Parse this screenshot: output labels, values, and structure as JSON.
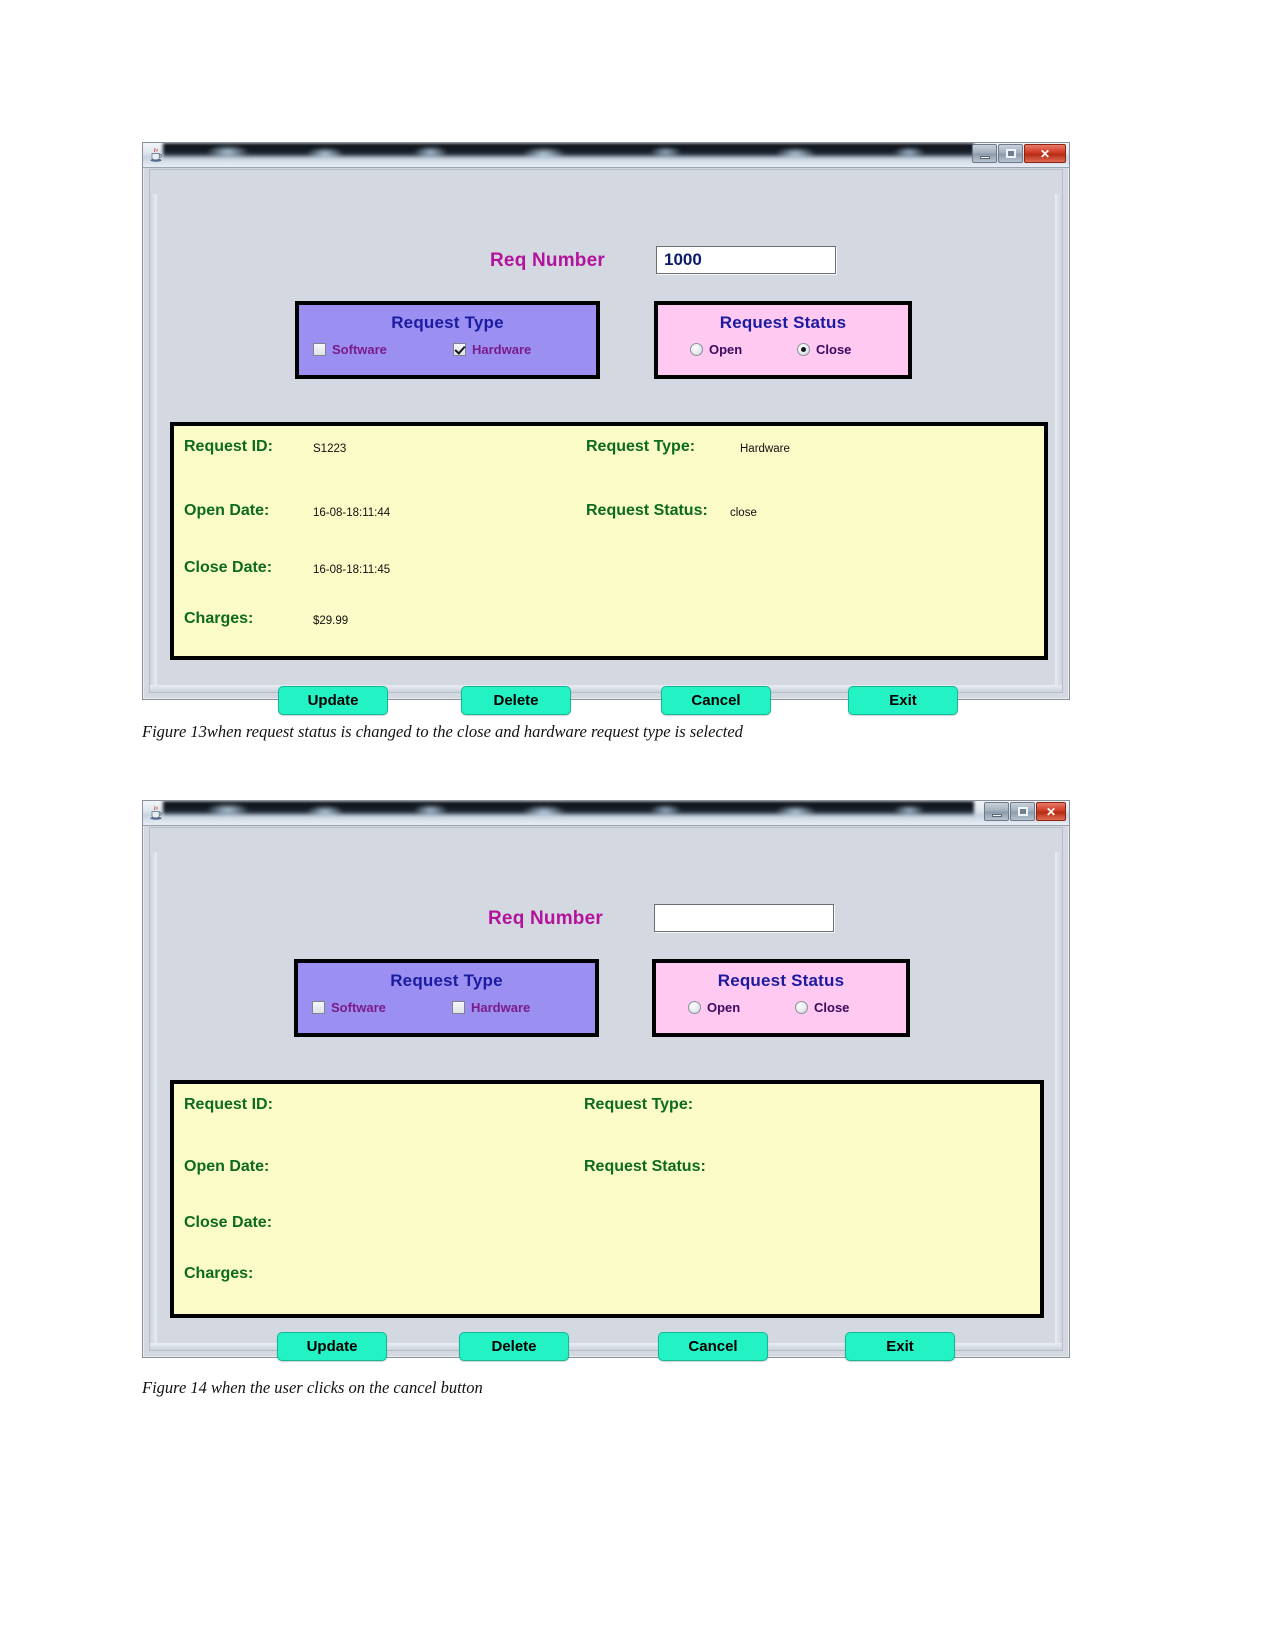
{
  "document": {
    "figures": [
      {
        "id": "figure-13",
        "caption": "Figure 13when request status is changed to the close and hardware request type is selected",
        "window": {
          "title": "",
          "app_icon": "java-coffee-cup-icon",
          "controls": {
            "minimize": "–",
            "maximize": "□",
            "close": "✕"
          }
        },
        "form": {
          "req_number": {
            "label": "Req Number",
            "value": "1000",
            "placeholder": ""
          },
          "request_type": {
            "title": "Request Type",
            "options": [
              {
                "label": "Software",
                "checked": false
              },
              {
                "label": "Hardware",
                "checked": true
              }
            ]
          },
          "request_status": {
            "title": "Request Status",
            "options": [
              {
                "label": "Open",
                "selected": false
              },
              {
                "label": "Close",
                "selected": true
              }
            ]
          },
          "details": [
            {
              "label": "Request ID:",
              "value": "S1223"
            },
            {
              "label": "Request Type:",
              "value": "Hardware"
            },
            {
              "label": "Open Date:",
              "value": "16-08-18:11:44"
            },
            {
              "label": "Request Status:",
              "value": "close"
            },
            {
              "label": "Close Date:",
              "value": "16-08-18:11:45"
            },
            {
              "label": "Charges:",
              "value": "$29.99"
            }
          ],
          "buttons": [
            {
              "label": "Update"
            },
            {
              "label": "Delete"
            },
            {
              "label": "Cancel"
            },
            {
              "label": "Exit"
            }
          ]
        }
      },
      {
        "id": "figure-14",
        "caption": "Figure 14 when the user clicks on the cancel button",
        "window": {
          "title": "",
          "app_icon": "java-coffee-cup-icon",
          "controls": {
            "minimize": "–",
            "maximize": "□",
            "close": "✕"
          }
        },
        "form": {
          "req_number": {
            "label": "Req Number",
            "value": "",
            "placeholder": ""
          },
          "request_type": {
            "title": "Request Type",
            "options": [
              {
                "label": "Software",
                "checked": false
              },
              {
                "label": "Hardware",
                "checked": false
              }
            ]
          },
          "request_status": {
            "title": "Request Status",
            "options": [
              {
                "label": "Open",
                "selected": false
              },
              {
                "label": "Close",
                "selected": false
              }
            ]
          },
          "details": [
            {
              "label": "Request ID:",
              "value": ""
            },
            {
              "label": "Request Type:",
              "value": ""
            },
            {
              "label": "Open Date:",
              "value": ""
            },
            {
              "label": "Request Status:",
              "value": ""
            },
            {
              "label": "Close Date:",
              "value": ""
            },
            {
              "label": "Charges:",
              "value": ""
            }
          ],
          "buttons": [
            {
              "label": "Update"
            },
            {
              "label": "Delete"
            },
            {
              "label": "Cancel"
            },
            {
              "label": "Exit"
            }
          ]
        }
      }
    ]
  },
  "colors": {
    "request_type_bg": "#9b90f2",
    "request_status_bg": "#ffc9f2",
    "details_bg": "#fbfbc7",
    "button_bg": "#22f2c4",
    "label_magenta": "#b3139c",
    "label_green": "#0d6b1f",
    "group_title_blue": "#1b1ba0",
    "window_bg": "#d4d8e0",
    "close_button_red": "#cf3a22"
  }
}
